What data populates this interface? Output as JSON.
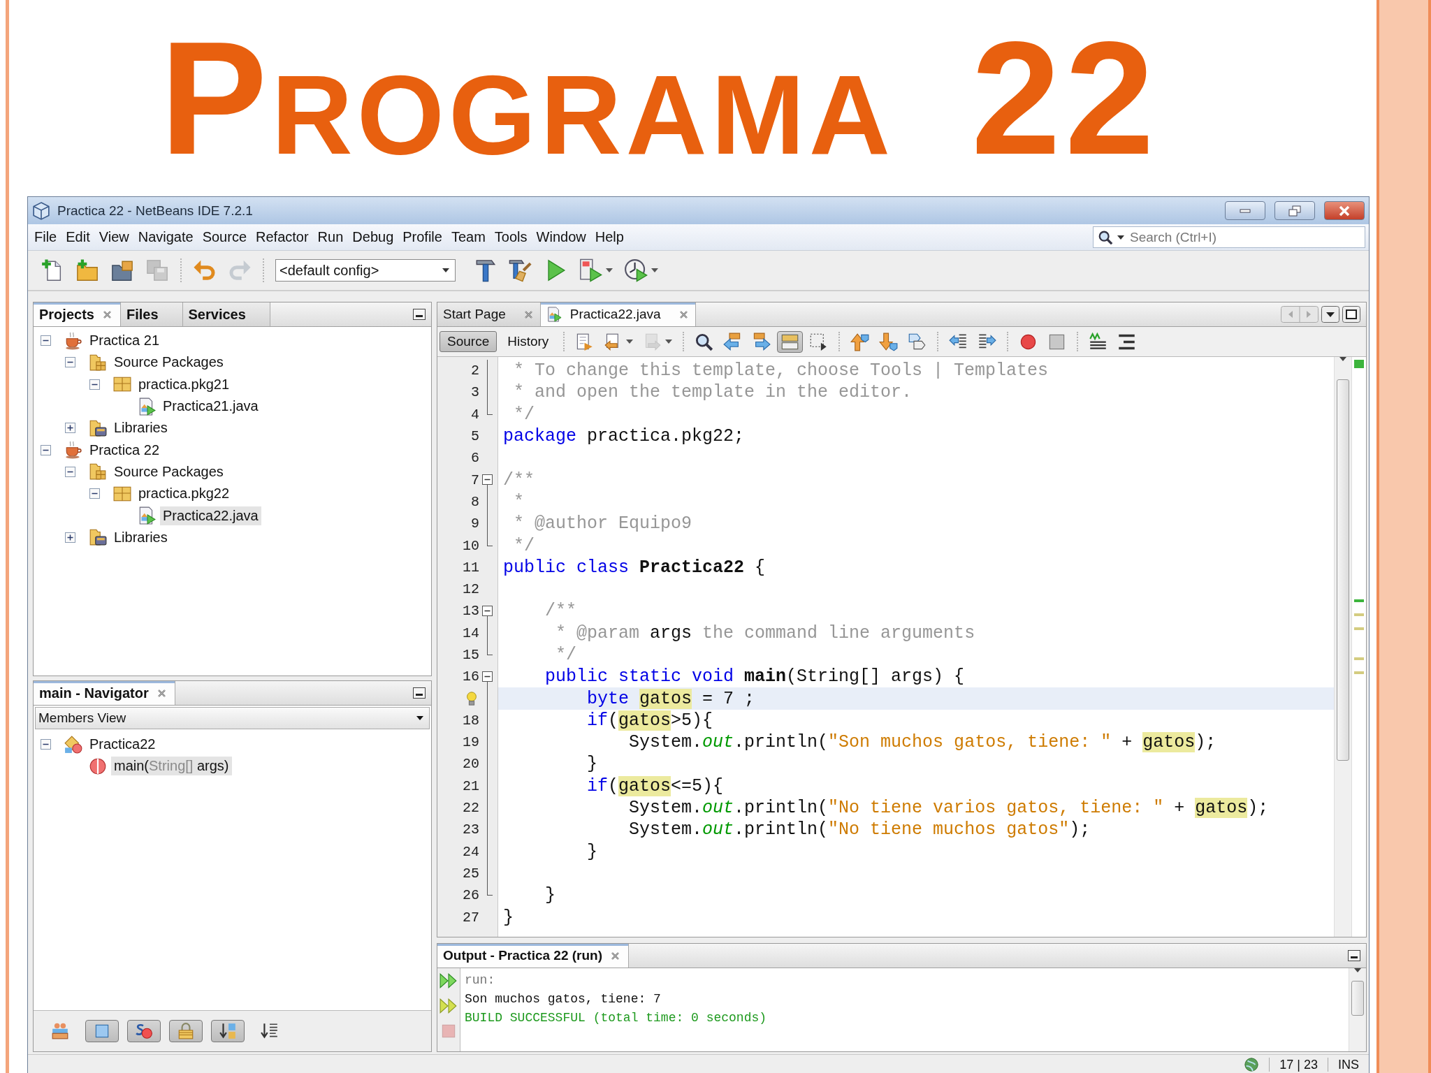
{
  "slide": {
    "title": "Programa 22"
  },
  "window": {
    "title": "Practica 22 - NetBeans IDE 7.2.1"
  },
  "menu": [
    "File",
    "Edit",
    "View",
    "Navigate",
    "Source",
    "Refactor",
    "Run",
    "Debug",
    "Profile",
    "Team",
    "Tools",
    "Window",
    "Help"
  ],
  "search": {
    "placeholder": "Search (Ctrl+I)"
  },
  "toolbar": [
    {
      "kind": "new-file",
      "disabled": false,
      "dropdown": false
    },
    {
      "kind": "new-project",
      "disabled": false,
      "dropdown": false
    },
    {
      "kind": "open-project",
      "disabled": false,
      "dropdown": false
    },
    {
      "kind": "save-all",
      "disabled": true,
      "dropdown": false
    },
    {
      "kind": "separator"
    },
    {
      "kind": "undo",
      "disabled": false,
      "dropdown": false
    },
    {
      "kind": "redo",
      "disabled": true,
      "dropdown": false
    },
    {
      "kind": "separator"
    },
    {
      "kind": "config",
      "value": "<default config>"
    },
    {
      "kind": "hammer",
      "disabled": false,
      "dropdown": false
    },
    {
      "kind": "clean-build",
      "disabled": false,
      "dropdown": false
    },
    {
      "kind": "run",
      "disabled": false,
      "dropdown": false
    },
    {
      "kind": "debug",
      "disabled": false,
      "dropdown": true
    },
    {
      "kind": "profile",
      "disabled": false,
      "dropdown": true
    }
  ],
  "projects": {
    "tabs": [
      {
        "label": "Projects",
        "selected": true,
        "closable": true
      },
      {
        "label": "Files",
        "selected": false,
        "closable": false
      },
      {
        "label": "Services",
        "selected": false,
        "closable": false
      }
    ],
    "tree": [
      {
        "label": "Practica 21",
        "kind": "project",
        "expanded": true,
        "selected": false,
        "children": [
          {
            "label": "Source Packages",
            "kind": "sources",
            "expanded": true,
            "selected": false,
            "children": [
              {
                "label": "practica.pkg21",
                "kind": "package",
                "expanded": true,
                "selected": false,
                "children": [
                  {
                    "label": "Practica21.java",
                    "kind": "java",
                    "selected": false
                  }
                ]
              }
            ]
          },
          {
            "label": "Libraries",
            "kind": "libraries",
            "expanded": false,
            "selected": false
          }
        ]
      },
      {
        "label": "Practica 22",
        "kind": "project",
        "expanded": true,
        "selected": false,
        "children": [
          {
            "label": "Source Packages",
            "kind": "sources",
            "expanded": true,
            "selected": false,
            "children": [
              {
                "label": "practica.pkg22",
                "kind": "package",
                "expanded": true,
                "selected": false,
                "children": [
                  {
                    "label": "Practica22.java",
                    "kind": "java",
                    "selected": true
                  }
                ]
              }
            ]
          },
          {
            "label": "Libraries",
            "kind": "libraries",
            "expanded": false,
            "selected": false
          }
        ]
      }
    ]
  },
  "navigator": {
    "title": "main - Navigator",
    "view": "Members View",
    "tree": [
      {
        "label": "Practica22",
        "kind": "class",
        "expanded": true,
        "selected": false,
        "children": [
          {
            "kind": "method",
            "selected": true,
            "parts": [
              {
                "text": "main(",
                "muted": false
              },
              {
                "text": "String[]",
                "muted": true
              },
              {
                "text": " args)",
                "muted": false
              }
            ]
          }
        ]
      }
    ],
    "filters": [
      {
        "kind": "inherited",
        "pressed": false
      },
      {
        "kind": "fields",
        "pressed": true
      },
      {
        "kind": "static",
        "pressed": true
      },
      {
        "kind": "nonpublic",
        "pressed": true
      },
      {
        "kind": "sort-name",
        "pressed": true
      },
      {
        "kind": "sort-source",
        "pressed": false
      }
    ]
  },
  "editor": {
    "tabs": [
      {
        "label": "Start Page",
        "kind": "page",
        "selected": false
      },
      {
        "label": "Practica22.java",
        "kind": "java",
        "selected": true
      }
    ],
    "views": [
      {
        "label": "Source",
        "selected": true
      },
      {
        "label": "History",
        "selected": false
      }
    ],
    "tools": [
      {
        "kind": "separator"
      },
      {
        "kind": "last-edit",
        "pressed": false,
        "disabled": false,
        "dropdown": false
      },
      {
        "kind": "back",
        "pressed": false,
        "disabled": false,
        "dropdown": true
      },
      {
        "kind": "forward",
        "pressed": false,
        "disabled": true,
        "dropdown": true
      },
      {
        "kind": "separator"
      },
      {
        "kind": "find",
        "pressed": false,
        "disabled": false,
        "dropdown": false
      },
      {
        "kind": "find-prev",
        "pressed": false,
        "disabled": false,
        "dropdown": false
      },
      {
        "kind": "find-next",
        "pressed": false,
        "disabled": false,
        "dropdown": false
      },
      {
        "kind": "highlight",
        "pressed": true,
        "disabled": false,
        "dropdown": false
      },
      {
        "kind": "rect-select",
        "pressed": false,
        "disabled": false,
        "dropdown": false
      },
      {
        "kind": "separator"
      },
      {
        "kind": "prev-bookmark",
        "pressed": false,
        "disabled": false,
        "dropdown": false
      },
      {
        "kind": "next-bookmark",
        "pressed": false,
        "disabled": false,
        "dropdown": false
      },
      {
        "kind": "toggle-bookmark",
        "pressed": false,
        "disabled": false,
        "dropdown": false
      },
      {
        "kind": "separator"
      },
      {
        "kind": "shift-left",
        "pressed": false,
        "disabled": false,
        "dropdown": false
      },
      {
        "kind": "shift-right",
        "pressed": false,
        "disabled": false,
        "dropdown": false
      },
      {
        "kind": "separator"
      },
      {
        "kind": "record",
        "pressed": false,
        "disabled": false,
        "dropdown": false
      },
      {
        "kind": "stop-macro",
        "pressed": false,
        "disabled": false,
        "dropdown": false
      },
      {
        "kind": "separator"
      },
      {
        "kind": "comment",
        "pressed": false,
        "disabled": false,
        "dropdown": false
      },
      {
        "kind": "uncomment",
        "pressed": false,
        "disabled": false,
        "dropdown": false
      }
    ],
    "lines": [
      {
        "number": "2",
        "fold_start": false,
        "fold_end": false,
        "current": false,
        "tokens": [
          {
            "kind": "comment",
            "text": " * To change this template, choose Tools | Templates"
          }
        ]
      },
      {
        "number": "3",
        "fold_start": false,
        "fold_end": false,
        "current": false,
        "tokens": [
          {
            "kind": "comment",
            "text": " * and open the template in the editor."
          }
        ]
      },
      {
        "number": "4",
        "fold_start": false,
        "fold_end": true,
        "current": false,
        "tokens": [
          {
            "kind": "comment",
            "text": " */"
          }
        ]
      },
      {
        "number": "5",
        "fold_start": false,
        "fold_end": false,
        "current": false,
        "tokens": [
          {
            "kind": "keyword",
            "text": "package"
          },
          {
            "kind": "plain",
            "text": " practica.pkg22;"
          }
        ]
      },
      {
        "number": "6",
        "fold_start": false,
        "fold_end": false
      },
      {
        "number": "7",
        "fold_start": true,
        "fold_end": false,
        "current": false,
        "tokens": [
          {
            "kind": "comment",
            "text": "/**"
          }
        ]
      },
      {
        "number": "8",
        "fold_start": false,
        "fold_end": false,
        "current": false,
        "tokens": [
          {
            "kind": "comment",
            "text": " *"
          }
        ]
      },
      {
        "number": "9",
        "fold_start": false,
        "fold_end": false,
        "current": false,
        "tokens": [
          {
            "kind": "comment",
            "text": " * @author Equipo9"
          }
        ]
      },
      {
        "number": "10",
        "fold_start": false,
        "fold_end": true,
        "current": false,
        "tokens": [
          {
            "kind": "comment",
            "text": " */"
          }
        ]
      },
      {
        "number": "11",
        "fold_start": false,
        "fold_end": false,
        "current": false,
        "tokens": [
          {
            "kind": "keyword",
            "text": "public class "
          },
          {
            "kind": "bold",
            "text": "Practica22"
          },
          {
            "kind": "plain",
            "text": " {"
          }
        ]
      },
      {
        "number": "12",
        "fold_start": false,
        "fold_end": false
      },
      {
        "number": "13",
        "fold_start": true,
        "fold_end": false,
        "current": false,
        "tokens": [
          {
            "kind": "comment",
            "text": "    /**"
          }
        ]
      },
      {
        "number": "14",
        "fold_start": false,
        "fold_end": false,
        "current": false,
        "tokens": [
          {
            "kind": "comment",
            "text": "     * @param "
          },
          {
            "kind": "plain",
            "text": "args"
          },
          {
            "kind": "comment",
            "text": " the command line arguments"
          }
        ]
      },
      {
        "number": "15",
        "fold_start": false,
        "fold_end": true,
        "current": false,
        "tokens": [
          {
            "kind": "comment",
            "text": "     */"
          }
        ]
      },
      {
        "number": "16",
        "fold_start": true,
        "fold_end": false,
        "current": false,
        "tokens": [
          {
            "kind": "keyword",
            "text": "    public static void"
          },
          {
            "kind": "bold",
            "text": " main"
          },
          {
            "kind": "plain",
            "text": "(String[] args) {"
          }
        ]
      },
      {
        "hint": true,
        "fold_start": false,
        "fold_end": false,
        "current": true,
        "tokens": [
          {
            "kind": "keyword",
            "text": "        byte "
          },
          {
            "kind": "occurrence",
            "text": "gatos"
          },
          {
            "kind": "plain",
            "text": " = 7 ;"
          }
        ]
      },
      {
        "number": "18",
        "fold_start": false,
        "fold_end": false,
        "current": false,
        "tokens": [
          {
            "kind": "keyword",
            "text": "        if"
          },
          {
            "kind": "plain",
            "text": "("
          },
          {
            "kind": "occurrence",
            "text": "gatos"
          },
          {
            "kind": "plain",
            "text": ">5){"
          }
        ]
      },
      {
        "number": "19",
        "fold_start": false,
        "fold_end": false,
        "current": false,
        "tokens": [
          {
            "kind": "plain",
            "text": "            System."
          },
          {
            "kind": "field",
            "text": "out"
          },
          {
            "kind": "plain",
            "text": ".println("
          },
          {
            "kind": "string",
            "text": "\"Son muchos gatos, tiene: \""
          },
          {
            "kind": "plain",
            "text": " + "
          },
          {
            "kind": "occurrence",
            "text": "gatos"
          },
          {
            "kind": "plain",
            "text": ");"
          }
        ]
      },
      {
        "number": "20",
        "fold_start": false,
        "fold_end": false,
        "current": false,
        "tokens": [
          {
            "kind": "plain",
            "text": "        }"
          }
        ]
      },
      {
        "number": "21",
        "fold_start": false,
        "fold_end": false,
        "current": false,
        "tokens": [
          {
            "kind": "keyword",
            "text": "        if"
          },
          {
            "kind": "plain",
            "text": "("
          },
          {
            "kind": "occurrence",
            "text": "gatos"
          },
          {
            "kind": "plain",
            "text": "<=5){"
          }
        ]
      },
      {
        "number": "22",
        "fold_start": false,
        "fold_end": false,
        "current": false,
        "tokens": [
          {
            "kind": "plain",
            "text": "            System."
          },
          {
            "kind": "field",
            "text": "out"
          },
          {
            "kind": "plain",
            "text": ".println("
          },
          {
            "kind": "string",
            "text": "\"No tiene varios gatos, tiene: \""
          },
          {
            "kind": "plain",
            "text": " + "
          },
          {
            "kind": "occurrence",
            "text": "gatos"
          },
          {
            "kind": "plain",
            "text": ");"
          }
        ]
      },
      {
        "number": "23",
        "fold_start": false,
        "fold_end": false,
        "current": false,
        "tokens": [
          {
            "kind": "plain",
            "text": "            System."
          },
          {
            "kind": "field",
            "text": "out"
          },
          {
            "kind": "plain",
            "text": ".println("
          },
          {
            "kind": "string",
            "text": "\"No tiene muchos gatos\""
          },
          {
            "kind": "plain",
            "text": ");"
          }
        ]
      },
      {
        "number": "24",
        "fold_start": false,
        "fold_end": false,
        "current": false,
        "tokens": [
          {
            "kind": "plain",
            "text": "        }"
          }
        ]
      },
      {
        "number": "25",
        "fold_start": false,
        "fold_end": false
      },
      {
        "number": "26",
        "fold_start": false,
        "fold_end": true,
        "current": false,
        "tokens": [
          {
            "kind": "plain",
            "text": "    }"
          }
        ]
      },
      {
        "number": "27",
        "fold_start": false,
        "fold_end": false,
        "current": false,
        "tokens": [
          {
            "kind": "plain",
            "text": "}"
          }
        ]
      }
    ]
  },
  "output": {
    "title": "Output - Practica 22 (run)",
    "actions": [
      {
        "kind": "rerun",
        "disabled": false
      },
      {
        "kind": "rerun-params",
        "disabled": false
      },
      {
        "kind": "stop",
        "disabled": true
      }
    ],
    "lines": [
      {
        "kind": "info",
        "text": "run:"
      },
      {
        "kind": "plain",
        "text": "Son muchos gatos, tiene: 7"
      },
      {
        "kind": "success",
        "text": "BUILD SUCCESSFUL (total time: 0 seconds)"
      }
    ]
  },
  "status": {
    "position": "17 | 23",
    "mode": "INS"
  }
}
